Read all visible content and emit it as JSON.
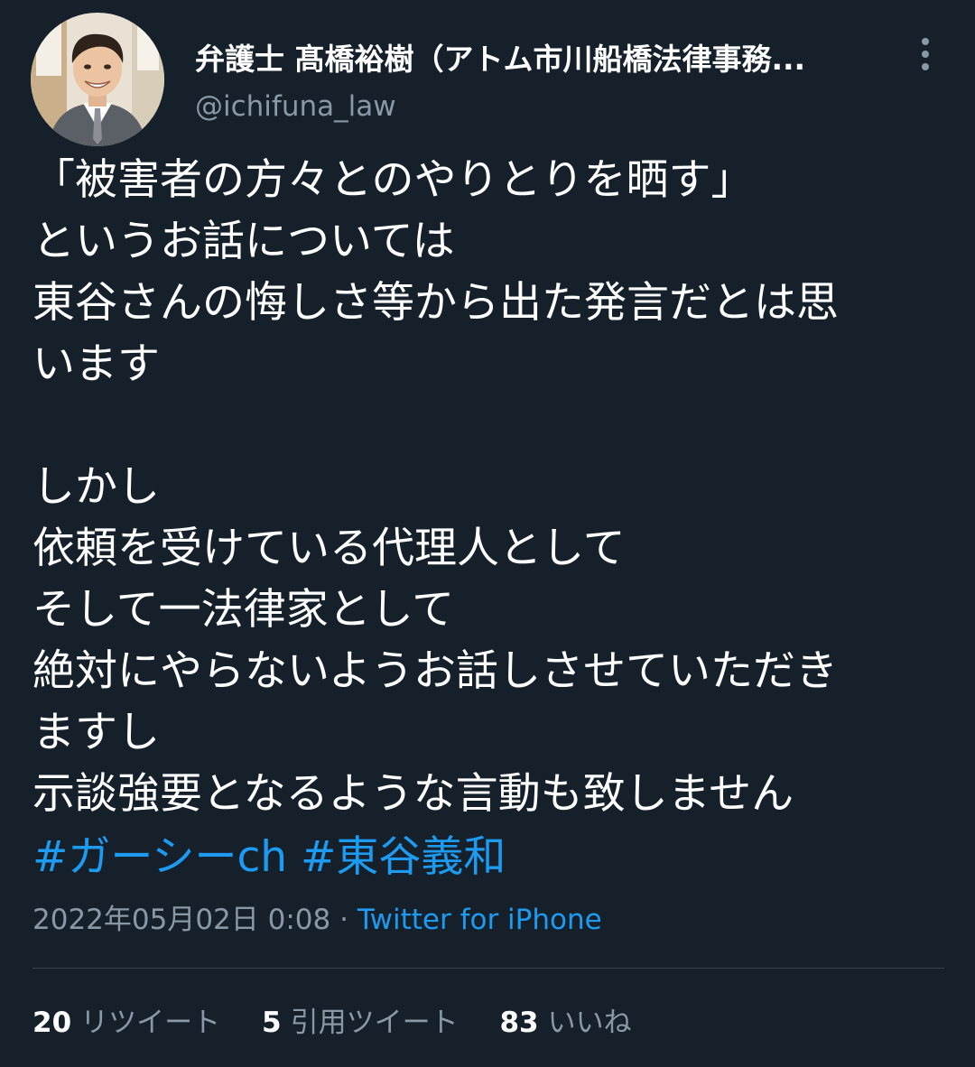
{
  "author": {
    "display_name": "弁護士 髙橋裕樹（アトム市川船橋法律事務...",
    "handle": "@ichifuna_law"
  },
  "tweet": {
    "lines": [
      "「被害者の方々とのやりとりを晒す」",
      "というお話については",
      "東谷さんの悔しさ等から出た発言だとは思",
      "います",
      "",
      "しかし",
      "依頼を受けている代理人として",
      "そして一法律家として",
      "絶対にやらないようお話しさせていただき",
      "ますし",
      "示談強要となるような言動も致しません"
    ],
    "hashtags": [
      "#ガーシーch",
      "#東谷義和"
    ]
  },
  "meta": {
    "timestamp": "2022年05月02日 0:08",
    "separator": " · ",
    "source": "Twitter for iPhone"
  },
  "stats": {
    "retweets_count": "20",
    "retweets_label": "リツイート",
    "quotes_count": "5",
    "quotes_label": "引用ツイート",
    "likes_count": "83",
    "likes_label": "いいね"
  },
  "colors": {
    "background": "#15202b",
    "link": "#1d9bf0",
    "secondary_text": "#8b98a5"
  },
  "icons": {
    "more": "vertical-ellipsis-icon"
  }
}
